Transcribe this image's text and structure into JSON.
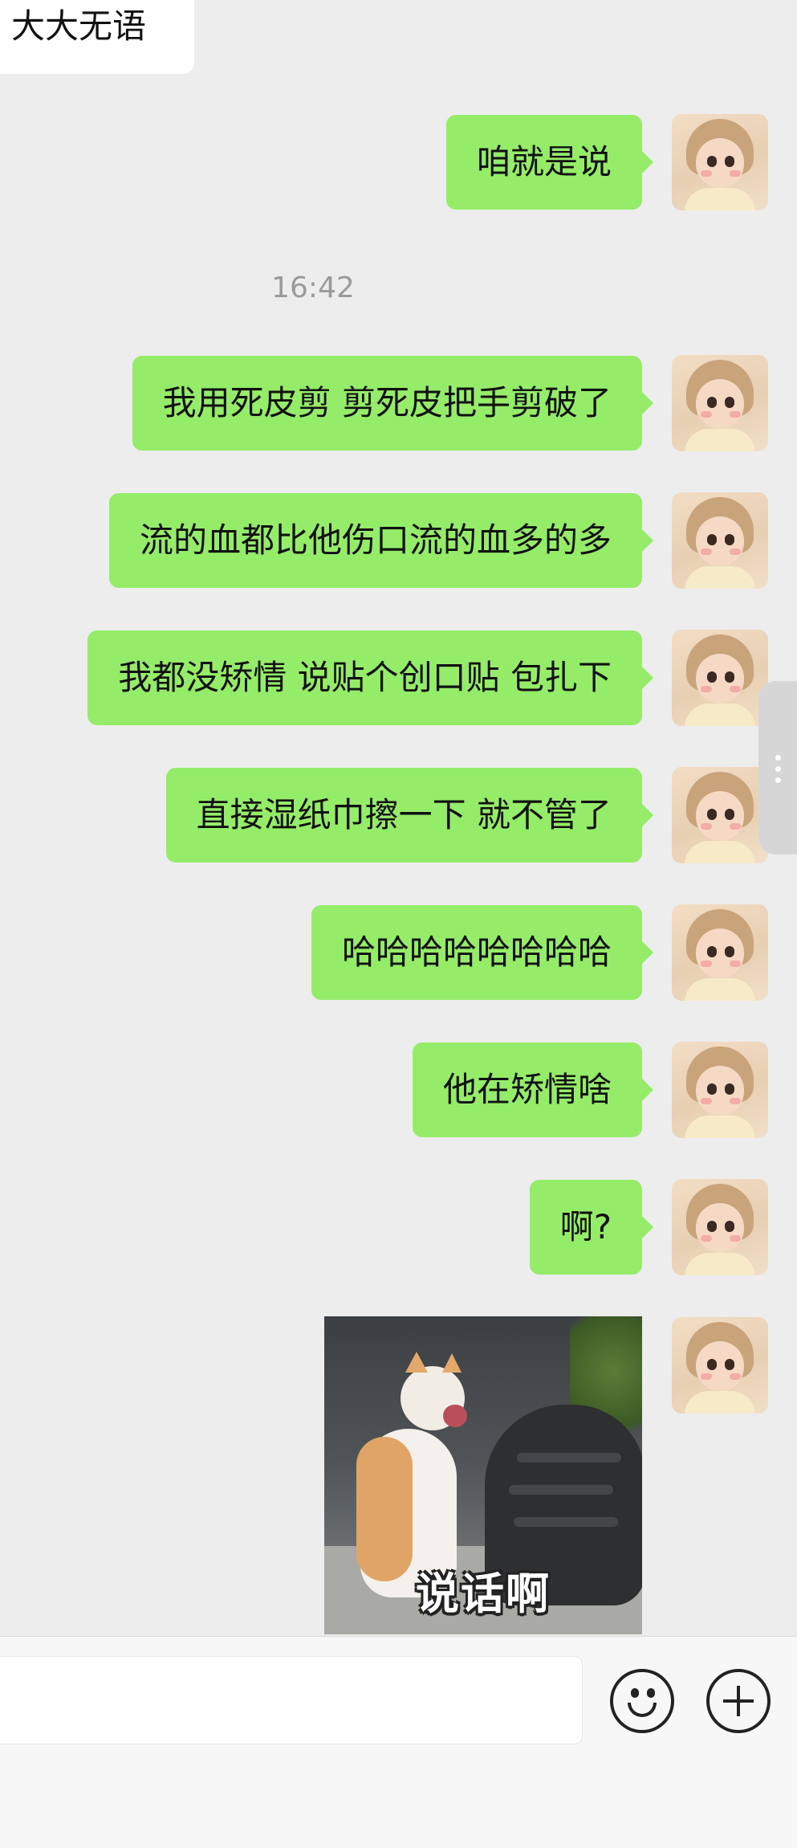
{
  "incoming": {
    "text": "大大无语"
  },
  "timestamp": "16:42",
  "messages": [
    {
      "text": "咱就是说"
    },
    {
      "text": "我用死皮剪 剪死皮把手剪破了"
    },
    {
      "text": "流的血都比他伤口流的血多的多"
    },
    {
      "text": "我都没矫情 说贴个创口贴 包扎下"
    },
    {
      "text": "直接湿纸巾擦一下 就不管了"
    },
    {
      "text": "哈哈哈哈哈哈哈哈"
    },
    {
      "text": "他在矫情啥"
    },
    {
      "text": "啊?"
    }
  ],
  "sticker": {
    "caption": "说话啊"
  },
  "input_bar": {
    "placeholder": "",
    "emoji_icon": "smiley-icon",
    "plus_icon": "plus-circle-icon"
  },
  "colors": {
    "background": "#ededed",
    "outgoing_bubble": "#95ec69",
    "incoming_bubble": "#ffffff"
  }
}
